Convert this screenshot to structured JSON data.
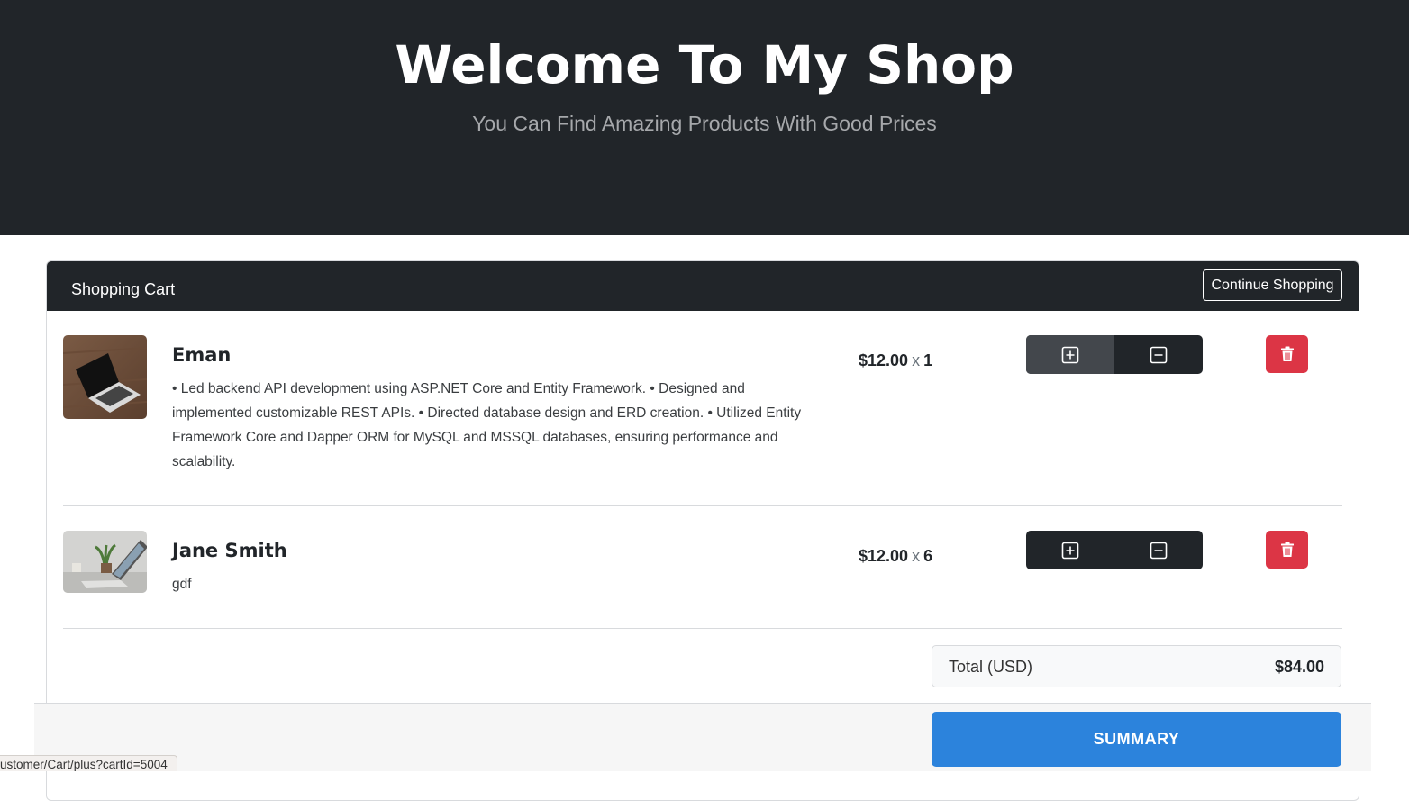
{
  "hero": {
    "title": "Welcome To My Shop",
    "subtitle": "You Can Find Amazing Products With Good Prices"
  },
  "cart": {
    "header_title": "Shopping Cart",
    "continue_label": "Continue Shopping",
    "items": [
      {
        "name": "Eman",
        "description": "• Led backend API development using ASP.NET Core and Entity Framework. • Designed and implemented customizable REST APIs. • Directed database design and ERD creation. • Utilized Entity Framework Core and Dapper ORM for MySQL and MSSQL databases, ensuring performance and scalability.",
        "price": "$12.00",
        "times": "x",
        "quantity": "1",
        "image_icon": "laptop-photo"
      },
      {
        "name": "Jane Smith",
        "description": "gdf",
        "price": "$12.00",
        "times": "x",
        "quantity": "6",
        "image_icon": "laptop-desk-photo"
      }
    ],
    "total_label": "Total (USD)",
    "total_value": "$84.00",
    "summary_label": "SUMMARY"
  },
  "status_bar": {
    "url": "ustomer/Cart/plus?cartId=5004"
  },
  "colors": {
    "dark": "#212529",
    "danger": "#dc3545",
    "primary": "#2c83dc"
  }
}
